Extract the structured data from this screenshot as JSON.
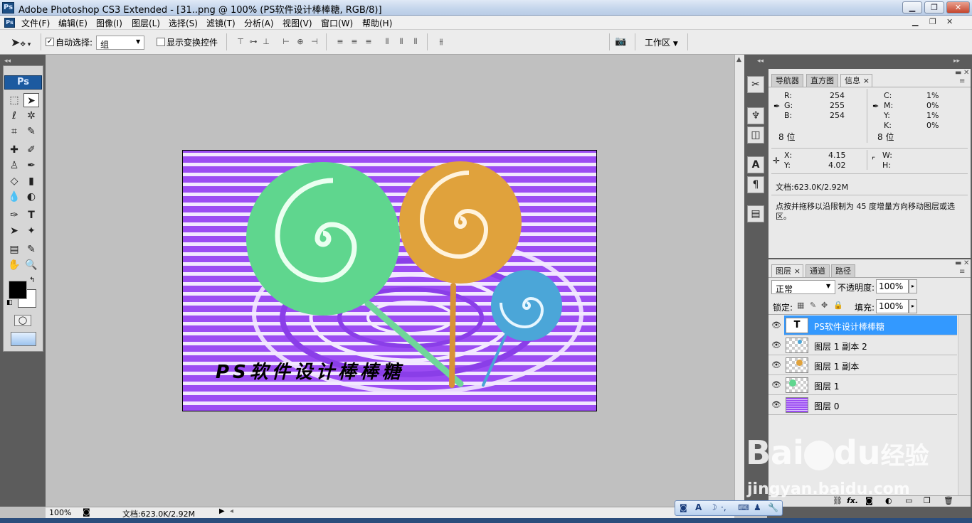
{
  "title": "Adobe Photoshop CS3 Extended - [31..png @ 100% (PS软件设计棒棒糖, RGB/8)]",
  "app_icon": "Ps",
  "menu": [
    "文件(F)",
    "编辑(E)",
    "图像(I)",
    "图层(L)",
    "选择(S)",
    "滤镜(T)",
    "分析(A)",
    "视图(V)",
    "窗口(W)",
    "帮助(H)"
  ],
  "options": {
    "auto_select_label": "自动选择:",
    "auto_select_value": "组",
    "show_transform_label": "显示变换控件",
    "workspace_label": "工作区"
  },
  "toolbox": {
    "logo": "Ps"
  },
  "document": {
    "text": "PS软件设计棒棒糖"
  },
  "status": {
    "zoom": "100%",
    "doc_info": "文档:623.0K/2.92M"
  },
  "info_panel": {
    "tabs": [
      "导航器",
      "直方图",
      "信息"
    ],
    "rgb": [
      {
        "k": "R:",
        "v": "254"
      },
      {
        "k": "G:",
        "v": "255"
      },
      {
        "k": "B:",
        "v": "254"
      }
    ],
    "cmyk": [
      {
        "k": "C:",
        "v": "1%"
      },
      {
        "k": "M:",
        "v": "0%"
      },
      {
        "k": "Y:",
        "v": "1%"
      },
      {
        "k": "K:",
        "v": "0%"
      }
    ],
    "bits_left": "8 位",
    "bits_right": "8 位",
    "x_label": "X:",
    "x_value": "4.15",
    "y_label": "Y:",
    "y_value": "4.02",
    "w_label": "W:",
    "h_label": "H:",
    "doc_info": "文档:623.0K/2.92M",
    "hint": "点按并拖移以沿限制为 45 度增量方向移动图层或选区。"
  },
  "layers_panel": {
    "tabs": [
      "图层",
      "通道",
      "路径"
    ],
    "blend_mode": "正常",
    "opacity_label": "不透明度:",
    "opacity_value": "100%",
    "lock_label": "锁定:",
    "fill_label": "填充:",
    "fill_value": "100%",
    "layers": [
      {
        "name": "PS软件设计棒棒糖",
        "thumb": "T"
      },
      {
        "name": "图层 1 副本 2",
        "thumb": ""
      },
      {
        "name": "图层 1 副本",
        "thumb": ""
      },
      {
        "name": "图层 1",
        "thumb": ""
      },
      {
        "name": "图层 0",
        "thumb": ""
      }
    ]
  },
  "watermark": {
    "brand": "Bai",
    "brand2": "du",
    "cn": "经验",
    "url": "jingyan.baidu.com"
  },
  "colors": {
    "purple": "#9b4cf2",
    "green": "#5fd68e",
    "orange": "#e0a23c",
    "blue": "#4ba6d8",
    "selected": "#3399ff"
  }
}
